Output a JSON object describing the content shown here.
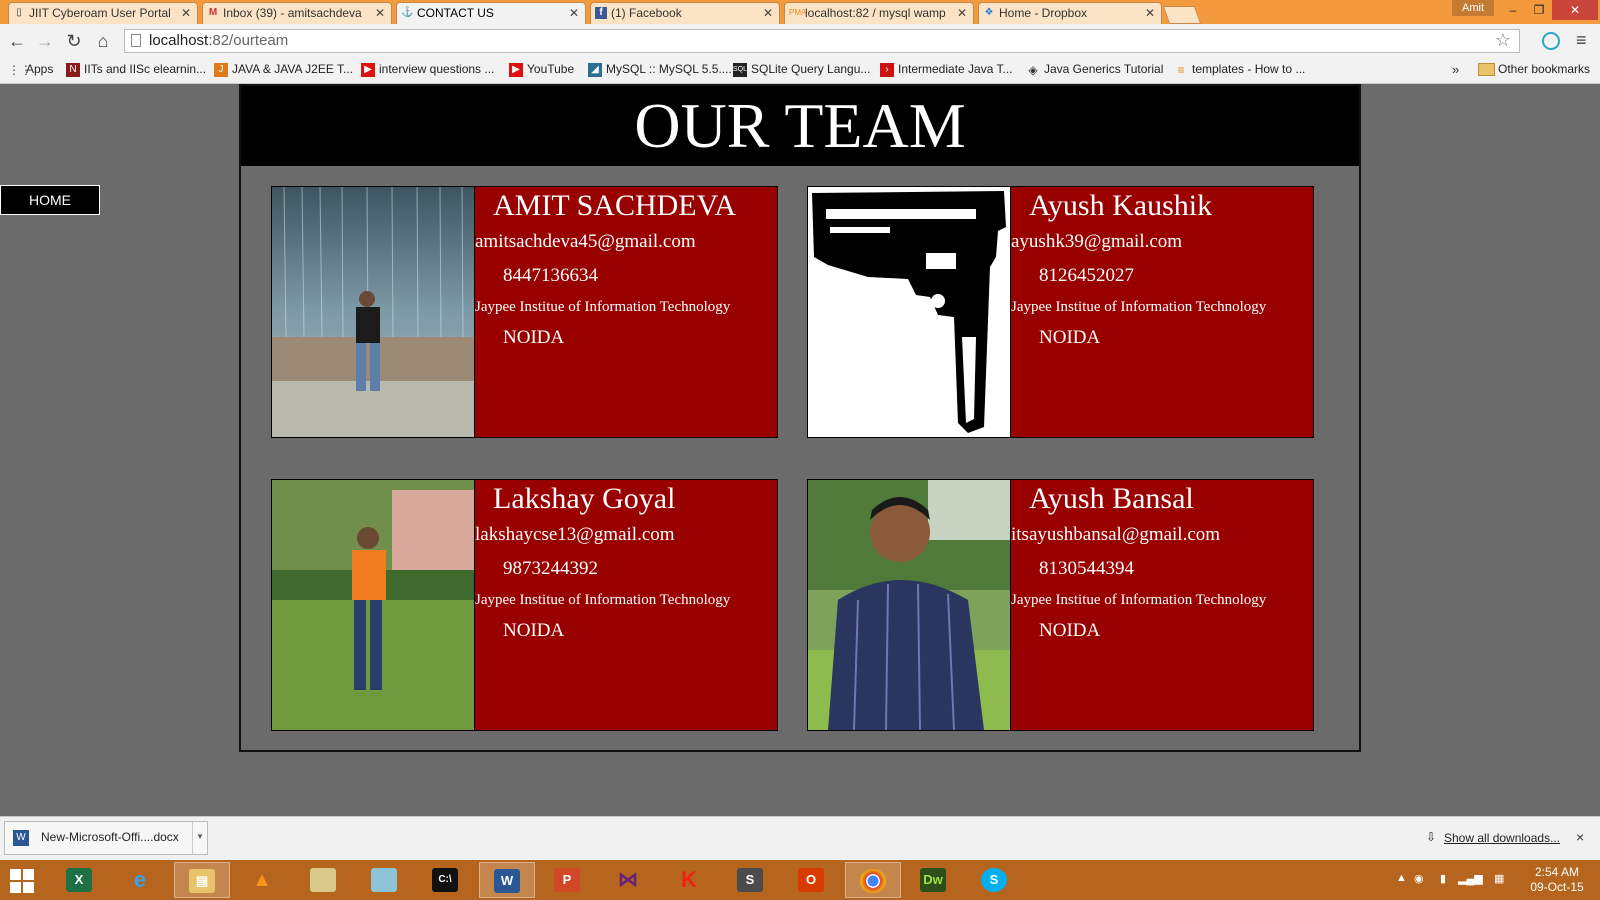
{
  "browser": {
    "tabs": [
      {
        "label": "JIIT Cyberoam User Portal",
        "icon": "page-icon"
      },
      {
        "label": "Inbox (39) - amitsachdeva",
        "icon": "gmail-icon"
      },
      {
        "label": "CONTACT US",
        "icon": "anchor-icon",
        "active": true
      },
      {
        "label": "(1) Facebook",
        "icon": "facebook-icon"
      },
      {
        "label": "localhost:82 / mysql wamp",
        "icon": "phpmyadmin-icon"
      },
      {
        "label": "Home - Dropbox",
        "icon": "dropbox-icon"
      }
    ],
    "user_badge": "Amit",
    "url_host": "localhost",
    "url_path": ":82/ourteam",
    "bookmarks": [
      {
        "label": "Apps",
        "icon": "apps-icon"
      },
      {
        "label": "IITs and IISc elearnin...",
        "icon": "nptel-icon"
      },
      {
        "label": "JAVA & JAVA J2EE T...",
        "icon": "java-icon"
      },
      {
        "label": "interview questions ...",
        "icon": "youtube-icon"
      },
      {
        "label": "YouTube",
        "icon": "youtube-icon"
      },
      {
        "label": "MySQL :: MySQL 5.5....",
        "icon": "mysql-icon"
      },
      {
        "label": "SQLite Query Langu...",
        "icon": "sqlite-icon"
      },
      {
        "label": "Intermediate Java T...",
        "icon": "tutorial-icon"
      },
      {
        "label": "Java Generics Tutorial",
        "icon": "diamond-icon"
      },
      {
        "label": "templates - How to ...",
        "icon": "stackoverflow-icon"
      }
    ],
    "bookmarks_more": "»",
    "other_bookmarks": "Other bookmarks"
  },
  "page": {
    "home_button": "HOME",
    "title": "OUR TEAM",
    "members": [
      {
        "name": "AMIT SACHDEVA",
        "email": "amitsachdeva45@gmail.com",
        "phone": "8447136634",
        "institute": "Jaypee Institue of Information Technology",
        "city": "NOIDA",
        "photo": "person-waterfall-photo"
      },
      {
        "name": "Ayush Kaushik",
        "email": "ayushk39@gmail.com",
        "phone": "8126452027",
        "institute": "Jaypee Institue of Information Technology",
        "city": "NOIDA",
        "photo": "pistol-drawing"
      },
      {
        "name": "Lakshay Goyal",
        "email": "lakshaycse13@gmail.com",
        "phone": "9873244392",
        "institute": "Jaypee Institue of Information Technology",
        "city": "NOIDA",
        "photo": "person-garden-photo"
      },
      {
        "name": "Ayush Bansal",
        "email": "itsayushbansal@gmail.com",
        "phone": "8130544394",
        "institute": "Jaypee Institue of Information Technology",
        "city": "NOIDA",
        "photo": "person-lawn-photo"
      }
    ],
    "colors": {
      "card_bg": "#990000",
      "header_bg": "#000000",
      "page_bg": "#6b6b6b"
    }
  },
  "downloads": {
    "file_name": "New-Microsoft-Offi....docx",
    "show_all": "Show all downloads...",
    "close": "×"
  },
  "taskbar": {
    "apps": [
      "excel",
      "internet-explorer",
      "file-explorer",
      "vlc",
      "folder",
      "notepad",
      "command-prompt",
      "word",
      "powerpoint",
      "visual-studio",
      "kaspersky",
      "sublime",
      "office",
      "chrome",
      "dreamweaver",
      "skype"
    ],
    "time": "2:54 AM",
    "date": "09-Oct-15"
  }
}
